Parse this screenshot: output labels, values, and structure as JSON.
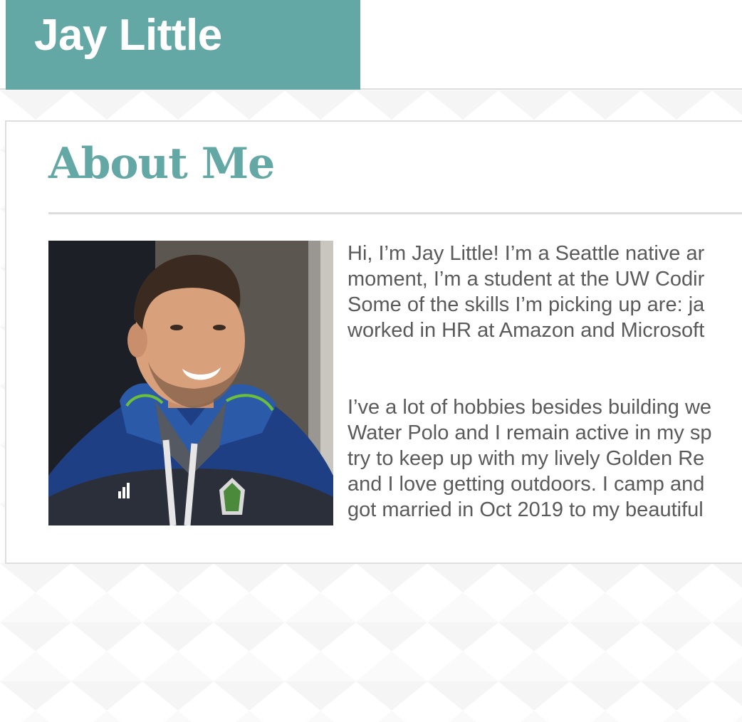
{
  "header": {
    "title": "Jay Little",
    "brand_color": "#63a8a5"
  },
  "about": {
    "heading": "About Me",
    "photo_alt": "Photo of Jay Little wearing a blue Sounders FC jacket",
    "paragraph_1": "Hi, I’m Jay Little! I’m a Seattle native ar\nmoment, I’m a student at the UW Codir\nSome of the skills I’m picking up are: ja\nworked in HR at Amazon and Microsoft",
    "paragraph_2": "I’ve a lot of hobbies besides building we\nWater Polo and I remain active in my sp\ntry to keep up with my lively Golden Re\nand I love getting outdoors. I camp and\ngot married in Oct 2019 to my beautiful"
  },
  "colors": {
    "accent": "#63a8a5",
    "text": "#5a5a5a",
    "border": "#dedede"
  }
}
